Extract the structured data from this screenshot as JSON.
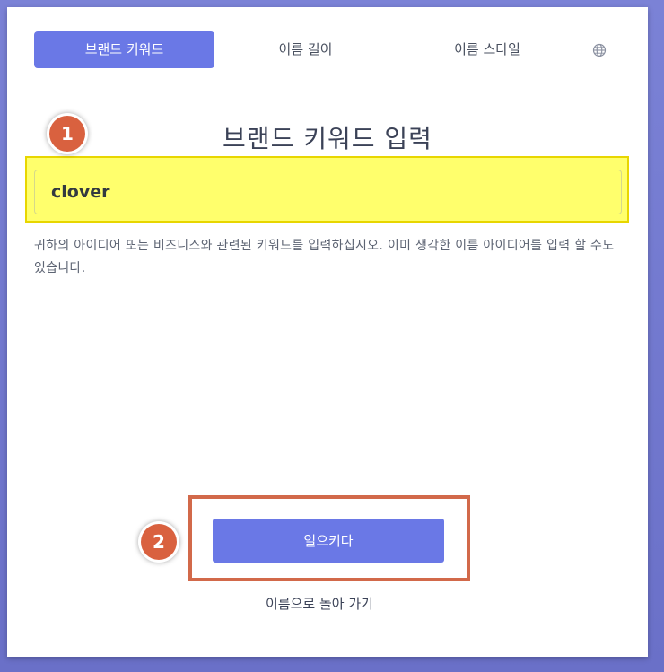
{
  "tabs": [
    {
      "label": "브랜드 키워드",
      "active": true
    },
    {
      "label": "이름 길이",
      "active": false
    },
    {
      "label": "이름 스타일",
      "active": false
    }
  ],
  "language_icon": "globe-icon",
  "heading": "브랜드 키워드 입력",
  "keyword_input": {
    "value": "clover"
  },
  "help_text": "귀하의 아이디어 또는 비즈니스와 관련된 키워드를 입력하십시오. 이미 생각한 이름 아이디어를 입력 할 수도 있습니다.",
  "primary_button": "일으키다",
  "back_link": "이름으로 돌아 가기",
  "annotations": {
    "step1": "1",
    "step2": "2"
  },
  "colors": {
    "accent": "#6a78e6",
    "highlight": "#ffff6c",
    "annotation": "#d9613f"
  }
}
